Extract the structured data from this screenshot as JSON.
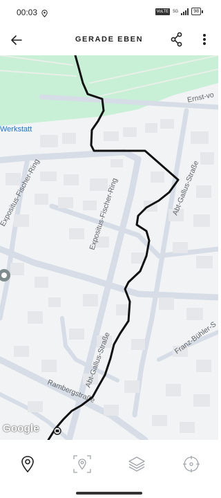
{
  "status_bar": {
    "time": "00:03",
    "volte": "VoLTE",
    "network": "5G",
    "battery": "98"
  },
  "header": {
    "title": "GERADE EBEN"
  },
  "map": {
    "poi_label": "Werkstatt",
    "streets": {
      "ernst": "Ernst-vo",
      "abt_gallus_top": "Abt-Gallus-Straße",
      "expositus_left": "Expositus-Fischer-Ring",
      "expositus_center": "Expositus-Fischer-Ring",
      "abt_gallus_bottom": "Abt-Gallus-Straße",
      "franz_buhler": "Franz-Bühler-S",
      "rambergstrasse": "Rambergstraße"
    },
    "attribution": "Google"
  },
  "bottom_bar": {
    "tools": [
      "location-pin-icon",
      "focus-location-icon",
      "layers-icon",
      "compass-icon"
    ]
  },
  "colors": {
    "map_background": "#f2f3f5",
    "park": "#c8f0d6",
    "roads": "#d6dde6",
    "buildings": "#e6e7ea",
    "track": "#111111",
    "poi": "#1a73e8"
  }
}
